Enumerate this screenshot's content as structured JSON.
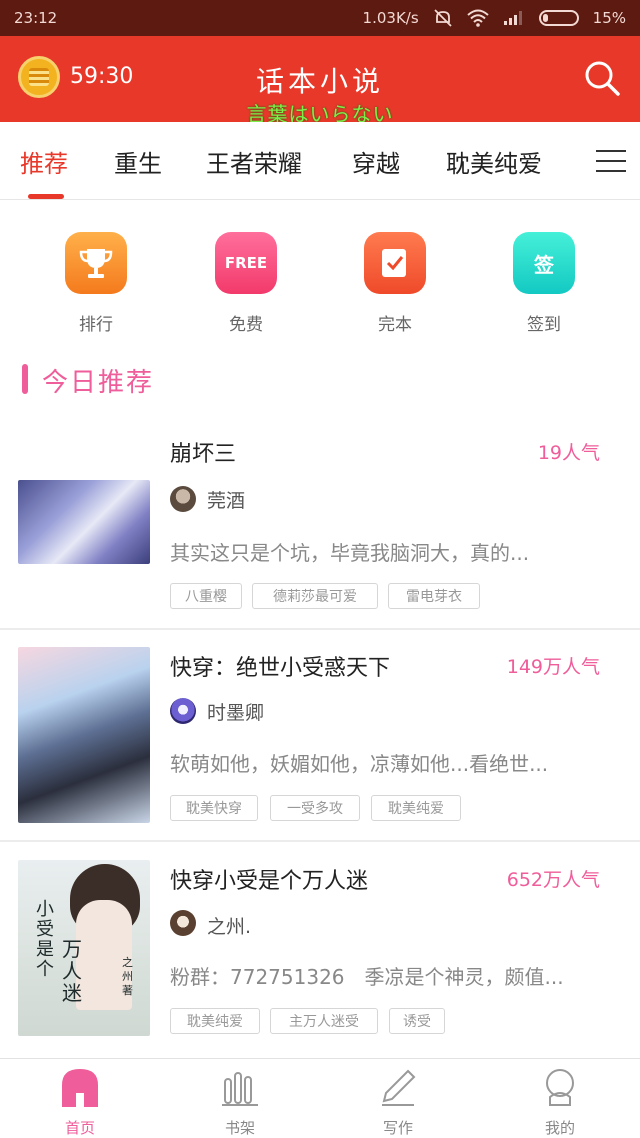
{
  "statusbar": {
    "time": "23:12",
    "speed": "1.03K/s",
    "battery": "15%"
  },
  "header": {
    "timer": "59:30",
    "title": "话本小说",
    "subtitle": "言葉はいらない"
  },
  "tabs": [
    {
      "label": "推荐",
      "active": true
    },
    {
      "label": "重生"
    },
    {
      "label": "王者荣耀"
    },
    {
      "label": "穿越"
    },
    {
      "label": "耽美纯爱"
    }
  ],
  "quick": [
    {
      "label": "排行",
      "icon": "trophy-icon"
    },
    {
      "label": "免费",
      "icon": "free-icon",
      "badge": "FREE"
    },
    {
      "label": "完本",
      "icon": "check-note-icon"
    },
    {
      "label": "签到",
      "icon": "sign-in-icon",
      "badge": "签"
    }
  ],
  "section": {
    "title": "今日推荐"
  },
  "books": [
    {
      "title": "崩坏三",
      "popularity": "19人气",
      "author": "莞酒",
      "desc": "其实这只是个坑，毕竟我脑洞大，真的...",
      "tags": [
        "八重樱",
        "德莉莎最可爱",
        "雷电芽衣"
      ]
    },
    {
      "title": "快穿：绝世小受惑天下",
      "popularity": "149万人气",
      "author": "时墨卿",
      "desc": "软萌如他，妖媚如他，凉薄如他...看绝世...",
      "tags": [
        "耽美快穿",
        "一受多攻",
        "耽美纯爱"
      ]
    },
    {
      "title": "快穿小受是个万人迷",
      "popularity": "652万人气",
      "author": "之州.",
      "desc": "粉群：772751326　季凉是个神灵，颇值...",
      "tags": [
        "耽美纯爱",
        "主万人迷受",
        "诱受"
      ],
      "cover_text": {
        "line1": "小受是个",
        "line2": "万人迷",
        "author": "之州 著"
      }
    }
  ],
  "bottomnav": [
    {
      "label": "首页",
      "active": true
    },
    {
      "label": "书架"
    },
    {
      "label": "写作"
    },
    {
      "label": "我的"
    }
  ],
  "colors": {
    "header": "#e8382a",
    "accent_pink": "#ef5d9a",
    "statusbar": "#5c1a10"
  }
}
